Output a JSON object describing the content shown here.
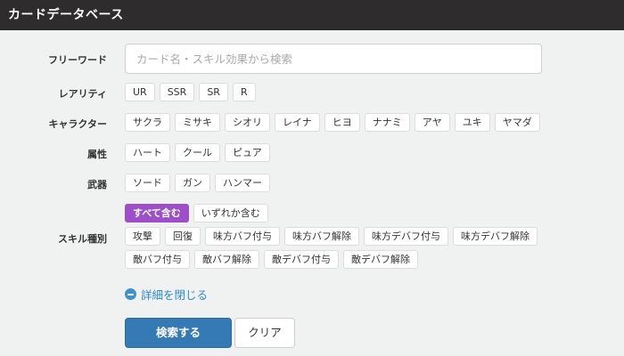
{
  "header": {
    "title": "カードデータベース"
  },
  "freeword": {
    "label": "フリーワード",
    "placeholder": "カード名・スキル効果から検索"
  },
  "rarity": {
    "label": "レアリティ",
    "options": [
      "UR",
      "SSR",
      "SR",
      "R"
    ]
  },
  "character": {
    "label": "キャラクター",
    "options": [
      "サクラ",
      "ミサキ",
      "シオリ",
      "レイナ",
      "ヒヨ",
      "ナナミ",
      "アヤ",
      "ユキ",
      "ヤマダ"
    ]
  },
  "attribute": {
    "label": "属性",
    "options": [
      "ハート",
      "クール",
      "ピュア"
    ]
  },
  "weapon": {
    "label": "武器",
    "options": [
      "ソード",
      "ガン",
      "ハンマー"
    ]
  },
  "skill": {
    "label": "スキル種別",
    "match_modes": [
      "すべて含む",
      "いずれか含む"
    ],
    "selected_mode": "すべて含む",
    "options_row1": [
      "攻撃",
      "回復",
      "味方バフ付与",
      "味方バフ解除",
      "味方デバフ付与",
      "味方デバフ解除"
    ],
    "options_row2": [
      "敵バフ付与",
      "敵バフ解除",
      "敵デバフ付与",
      "敵デバフ解除"
    ]
  },
  "details_toggle": {
    "label": "詳細を閉じる",
    "icon": "minus-circle-icon"
  },
  "actions": {
    "search_label": "検索する",
    "clear_label": "クリア"
  },
  "colors": {
    "header_bg": "#2f2c2e",
    "accent_purple": "#9d4fc9",
    "primary_blue": "#3579b5",
    "link_blue": "#2f8bc8"
  }
}
